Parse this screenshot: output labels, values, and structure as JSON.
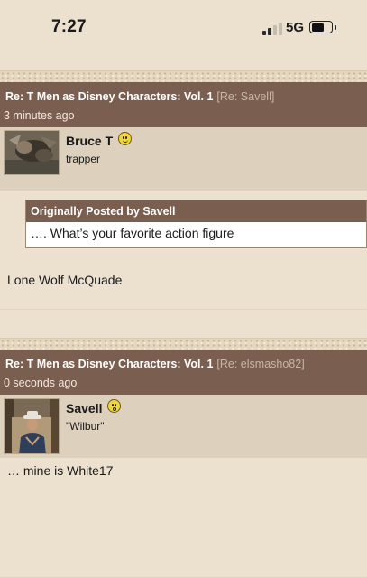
{
  "status_bar": {
    "time": "7:27",
    "network": "5G"
  },
  "posts": [
    {
      "title": "Re: T Men as Disney Characters: Vol. 1",
      "reply_to": "[Re: Savell]",
      "time_ago": "3 minutes ago",
      "author": "Bruce T",
      "author_title": "trapper",
      "quote": {
        "header": "Originally Posted by Savell",
        "text": "…. What’s your favorite action figure"
      },
      "body": "Lone Wolf McQuade"
    },
    {
      "title": "Re: T Men as Disney Characters: Vol. 1",
      "reply_to": "[Re: elsmasho82]",
      "time_ago": "0 seconds ago",
      "author": "Savell",
      "author_title": "\"Wilbur\"",
      "body": "… mine is White17"
    }
  ],
  "icons": {
    "signal": "signal-bars-icon",
    "battery": "battery-icon",
    "smiley_1": "smile-icon",
    "smiley_2": "shocked-icon"
  },
  "colors": {
    "header": "#7a5e4f",
    "background": "#ece1cf",
    "author_band": "#ddd0bc"
  }
}
